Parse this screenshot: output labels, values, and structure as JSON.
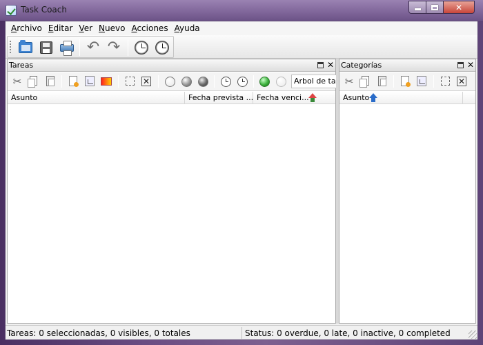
{
  "window": {
    "title": "Task Coach",
    "controls": {
      "minimize": "",
      "maximize": "",
      "close": "✕"
    }
  },
  "menu": {
    "items": [
      {
        "accel": "A",
        "rest": "rchivo"
      },
      {
        "accel": "E",
        "rest": "ditar"
      },
      {
        "accel": "V",
        "rest": "er"
      },
      {
        "accel": "N",
        "rest": "uevo"
      },
      {
        "accel": "A",
        "rest": "cciones"
      },
      {
        "accel": "A",
        "rest": "yuda"
      }
    ]
  },
  "main_toolbar": {
    "icons": [
      "open-folder-icon",
      "save-icon",
      "print-icon",
      "undo-icon",
      "redo-icon",
      "start-tracking-clock-icon",
      "stop-tracking-clock-icon"
    ],
    "undo_glyph": "↶",
    "redo_glyph": "↷"
  },
  "tasks_panel": {
    "title": "Tareas",
    "close_glyph": "✕",
    "tree_view_label": "Arbol de tare",
    "columns": {
      "subject": "Asunto",
      "planned_start": "Fecha prevista ...",
      "due_date": "Fecha venci..."
    },
    "toolbar_glyphs": {
      "cut": "✂",
      "delete": "✕"
    }
  },
  "categories_panel": {
    "title": "Categorías",
    "close_glyph": "✕",
    "columns": {
      "subject": "Asunto"
    },
    "toolbar_glyphs": {
      "cut": "✂",
      "delete": "✕"
    }
  },
  "status": {
    "left": "Tareas: 0 seleccionadas, 0 visibles, 0 totales",
    "right": "Status: 0 overdue, 0 late, 0 inactive, 0 completed"
  },
  "colors": {
    "title_bar": "#7f6599",
    "close_button": "#c8453a",
    "accent_blue": "#2a6cc9"
  }
}
